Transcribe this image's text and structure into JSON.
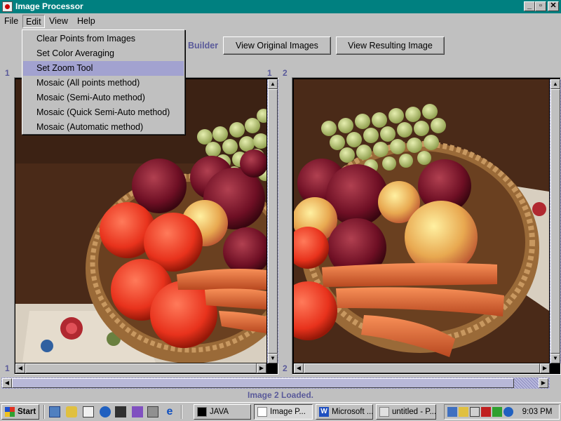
{
  "window": {
    "title": "Image Processor",
    "controls": {
      "minimize": "_",
      "maximize": "▫",
      "close": "✕"
    }
  },
  "menubar": {
    "items": [
      {
        "label": "File",
        "active": false
      },
      {
        "label": "Edit",
        "active": true
      },
      {
        "label": "View",
        "active": false
      },
      {
        "label": "Help",
        "active": false
      }
    ]
  },
  "edit_menu": {
    "items": [
      {
        "label": "Clear Points from Images",
        "selected": false
      },
      {
        "label": "Set Color Averaging",
        "selected": false
      },
      {
        "label": "Set Zoom Tool",
        "selected": true
      },
      {
        "label": "Mosaic (All points method)",
        "selected": false
      },
      {
        "label": "Mosaic (Semi-Auto method)",
        "selected": false
      },
      {
        "label": "Mosaic (Quick Semi-Auto method)",
        "selected": false
      },
      {
        "label": "Mosaic (Automatic method)",
        "selected": false
      }
    ]
  },
  "toolbar": {
    "partial_label": "Builder",
    "view_original_label": "View Original Images",
    "view_resulting_label": "View Resulting Image"
  },
  "panels": {
    "left": {
      "top_left_number": "1",
      "top_right_number": "1",
      "bottom_number": "1"
    },
    "right": {
      "top_number": "2",
      "bottom_number": "2"
    }
  },
  "status": {
    "text": "Image 2 Loaded."
  },
  "taskbar": {
    "start_label": "Start",
    "tasks": [
      {
        "label": "JAVA",
        "icon": "msdos-icon",
        "pressed": false
      },
      {
        "label": "Image P...",
        "icon": "java-app-icon",
        "pressed": true
      },
      {
        "label": "Microsoft ...",
        "icon": "word-icon",
        "pressed": false
      },
      {
        "label": "untitled - P...",
        "icon": "paint-icon",
        "pressed": false
      }
    ],
    "quick_launch": [
      "show-desktop-icon",
      "hand-tool-icon",
      "notepad-icon",
      "globe-icon",
      "media-icon",
      "scanner-icon",
      "calculator-icon",
      "ie-icon"
    ],
    "tray_icons": [
      "network-icon",
      "pencil-icon",
      "volume-icon",
      "ati-icon",
      "game-icon",
      "settings-icon"
    ],
    "clock": "9:03 PM"
  },
  "colors": {
    "title_bar": "#008080",
    "accent_text": "#5a5a9a",
    "menu_selection": "#a2a2d0",
    "window_bg": "#c0c0c0"
  }
}
